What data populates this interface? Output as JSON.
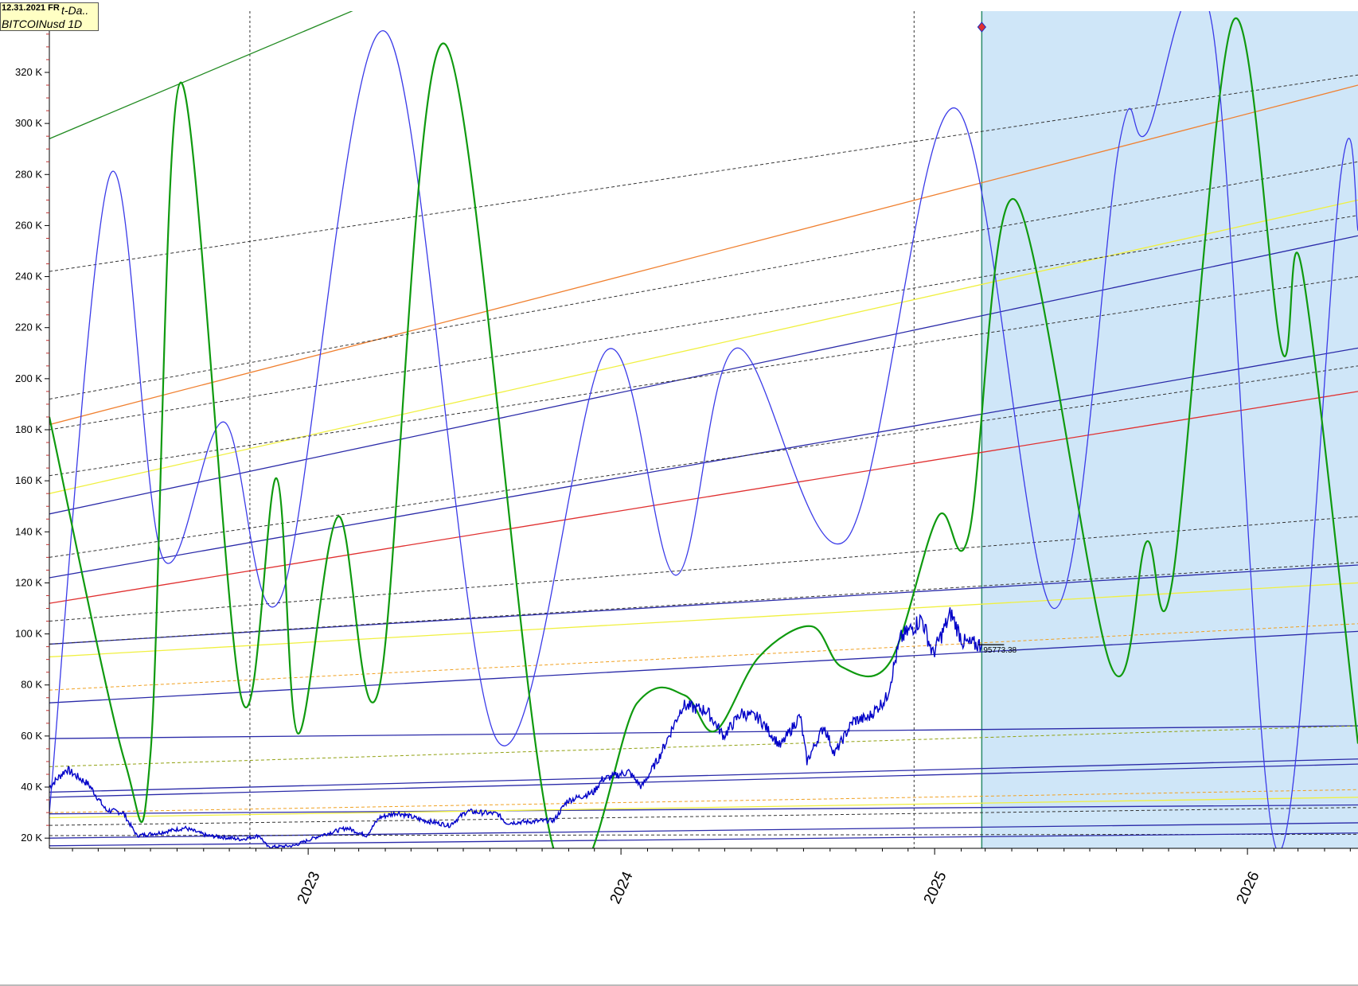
{
  "info_box": {
    "date": "12.31.2021 FR",
    "suffix": "t-Da..",
    "symbol": "BITCOINusd 1D"
  },
  "price_marker": "95773.38",
  "colors": {
    "forecast_zone": "#cfe6f8",
    "price_series": "#0000c8",
    "blue_wave": "#3a3ae8",
    "green_wave": "#0f9a0f"
  },
  "chart_data": {
    "type": "line",
    "title": "",
    "xlabel": "",
    "ylabel": "",
    "x_axis": {
      "type": "date",
      "range": [
        "2022-03-05",
        "2026-05-10"
      ],
      "tick_labels": [
        "2023",
        "2024",
        "2025",
        "2026"
      ],
      "tick_dates": [
        "2023-01-01",
        "2024-01-01",
        "2025-01-01",
        "2026-01-01"
      ]
    },
    "y_axis": {
      "range": [
        16000,
        344000
      ],
      "ticks": [
        20000,
        40000,
        60000,
        80000,
        100000,
        120000,
        140000,
        160000,
        180000,
        200000,
        220000,
        240000,
        260000,
        280000,
        300000,
        320000
      ],
      "tick_labels": [
        "20 K",
        "40 K",
        "60 K",
        "80 K",
        "100 K",
        "120 K",
        "140 K",
        "160 K",
        "180 K",
        "200 K",
        "220 K",
        "240 K",
        "260 K",
        "280 K",
        "300 K",
        "320 K"
      ]
    },
    "grid": false,
    "vertical_markers": [
      "2022-10-25",
      "2024-12-08"
    ],
    "forecast_start": "2025-02-25",
    "last_price": 95773.38,
    "series": [
      {
        "role": "price",
        "points": [
          [
            "2022-03-05",
            40000
          ],
          [
            "2022-03-25",
            47000
          ],
          [
            "2022-04-20",
            41000
          ],
          [
            "2022-05-10",
            31000
          ],
          [
            "2022-05-30",
            30000
          ],
          [
            "2022-06-15",
            21000
          ],
          [
            "2022-07-10",
            22000
          ],
          [
            "2022-08-10",
            24000
          ],
          [
            "2022-09-05",
            21000
          ],
          [
            "2022-10-15",
            19500
          ],
          [
            "2022-11-05",
            21000
          ],
          [
            "2022-11-15",
            16500
          ],
          [
            "2022-12-15",
            17000
          ],
          [
            "2023-01-15",
            21000
          ],
          [
            "2023-02-15",
            24000
          ],
          [
            "2023-03-10",
            21000
          ],
          [
            "2023-03-25",
            28000
          ],
          [
            "2023-04-15",
            30000
          ],
          [
            "2023-05-15",
            27000
          ],
          [
            "2023-06-15",
            25000
          ],
          [
            "2023-07-05",
            30500
          ],
          [
            "2023-08-10",
            29500
          ],
          [
            "2023-08-20",
            26000
          ],
          [
            "2023-09-20",
            26500
          ],
          [
            "2023-10-15",
            27000
          ],
          [
            "2023-10-30",
            34500
          ],
          [
            "2023-11-30",
            38000
          ],
          [
            "2023-12-10",
            43000
          ],
          [
            "2024-01-10",
            46000
          ],
          [
            "2024-01-25",
            40000
          ],
          [
            "2024-02-15",
            52000
          ],
          [
            "2024-03-13",
            72000
          ],
          [
            "2024-04-10",
            70000
          ],
          [
            "2024-04-30",
            60000
          ],
          [
            "2024-05-20",
            69000
          ],
          [
            "2024-06-10",
            67000
          ],
          [
            "2024-07-05",
            56000
          ],
          [
            "2024-07-28",
            68000
          ],
          [
            "2024-08-05",
            50000
          ],
          [
            "2024-08-25",
            64000
          ],
          [
            "2024-09-06",
            53000
          ],
          [
            "2024-09-28",
            66000
          ],
          [
            "2024-10-15",
            67000
          ],
          [
            "2024-11-06",
            75000
          ],
          [
            "2024-11-22",
            98000
          ],
          [
            "2024-12-17",
            106000
          ],
          [
            "2024-12-30",
            92000
          ],
          [
            "2025-01-20",
            108000
          ],
          [
            "2025-02-03",
            97000
          ],
          [
            "2025-02-10",
            96000
          ],
          [
            "2025-02-25",
            95773
          ]
        ]
      },
      {
        "role": "blue-cycle",
        "points": [
          [
            "2022-03-05",
            30000
          ],
          [
            "2022-05-15",
            280000
          ],
          [
            "2022-07-15",
            130000
          ],
          [
            "2022-09-25",
            183000
          ],
          [
            "2022-12-01",
            115000
          ],
          [
            "2023-04-01",
            336000
          ],
          [
            "2023-08-10",
            58000
          ],
          [
            "2023-12-15",
            211000
          ],
          [
            "2024-03-05",
            123000
          ],
          [
            "2024-05-15",
            212000
          ],
          [
            "2024-09-20",
            137000
          ],
          [
            "2025-01-25",
            306000
          ],
          [
            "2025-05-20",
            110000
          ],
          [
            "2025-08-05",
            293000
          ],
          [
            "2025-09-05",
            296000
          ],
          [
            "2025-11-20",
            340000
          ],
          [
            "2026-02-05",
            15000
          ],
          [
            "2026-04-20",
            280000
          ],
          [
            "2026-05-10",
            258000
          ]
        ]
      },
      {
        "role": "green-cycle",
        "points": [
          [
            "2022-03-05",
            185000
          ],
          [
            "2022-06-01",
            50000
          ],
          [
            "2022-07-01",
            53000
          ],
          [
            "2022-08-05",
            316000
          ],
          [
            "2022-10-15",
            75000
          ],
          [
            "2022-11-25",
            161000
          ],
          [
            "2022-12-20",
            61000
          ],
          [
            "2023-02-05",
            146000
          ],
          [
            "2023-03-25",
            79000
          ],
          [
            "2023-06-10",
            331000
          ],
          [
            "2023-10-15",
            15000
          ],
          [
            "2024-01-20",
            73000
          ],
          [
            "2024-03-15",
            76000
          ],
          [
            "2024-04-20",
            62000
          ],
          [
            "2024-06-10",
            91000
          ],
          [
            "2024-08-10",
            103000
          ],
          [
            "2024-09-15",
            87000
          ],
          [
            "2024-11-10",
            89000
          ],
          [
            "2025-01-05",
            146000
          ],
          [
            "2025-02-10",
            139000
          ],
          [
            "2025-04-05",
            270000
          ],
          [
            "2025-07-25",
            88000
          ],
          [
            "2025-09-05",
            136000
          ],
          [
            "2025-10-05",
            120000
          ],
          [
            "2025-12-15",
            340000
          ],
          [
            "2026-02-10",
            211000
          ],
          [
            "2026-03-05",
            244000
          ],
          [
            "2026-05-10",
            57000
          ]
        ]
      },
      {
        "role": "trend-lines",
        "segments": [
          {
            "color": "#228b22",
            "dash": "",
            "from": [
              "2022-03-05",
              294000
            ],
            "to": [
              "2023-02-28",
              345000
            ]
          },
          {
            "color": "#333333",
            "dash": "4,3",
            "from": [
              "2022-03-05",
              242000
            ],
            "to": [
              "2026-05-10",
              319000
            ]
          },
          {
            "color": "#f08030",
            "dash": "",
            "from": [
              "2022-03-05",
              182000
            ],
            "to": [
              "2026-05-10",
              315000
            ]
          },
          {
            "color": "#333333",
            "dash": "4,3",
            "from": [
              "2022-03-05",
              192000
            ],
            "to": [
              "2026-05-10",
              285000
            ]
          },
          {
            "color": "#f0f040",
            "dash": "",
            "from": [
              "2022-03-05",
              155000
            ],
            "to": [
              "2026-05-10",
              270000
            ]
          },
          {
            "color": "#333333",
            "dash": "4,3",
            "from": [
              "2022-03-05",
              180000
            ],
            "to": [
              "2026-05-10",
              264000
            ]
          },
          {
            "color": "#2a2aa8",
            "dash": "",
            "from": [
              "2022-03-05",
              147000
            ],
            "to": [
              "2026-05-10",
              256000
            ]
          },
          {
            "color": "#333333",
            "dash": "4,3",
            "from": [
              "2022-03-05",
              162000
            ],
            "to": [
              "2026-05-10",
              240000
            ]
          },
          {
            "color": "#2a2aa8",
            "dash": "",
            "from": [
              "2022-03-05",
              122000
            ],
            "to": [
              "2026-05-10",
              212000
            ]
          },
          {
            "color": "#333333",
            "dash": "4,3",
            "from": [
              "2022-03-05",
              130000
            ],
            "to": [
              "2026-05-10",
              205000
            ]
          },
          {
            "color": "#e03030",
            "dash": "",
            "from": [
              "2022-03-05",
              112000
            ],
            "to": [
              "2026-05-10",
              195000
            ]
          },
          {
            "color": "#333333",
            "dash": "4,3",
            "from": [
              "2022-03-05",
              105000
            ],
            "to": [
              "2026-05-10",
              146000
            ]
          },
          {
            "color": "#f0f040",
            "dash": "",
            "from": [
              "2022-03-05",
              91000
            ],
            "to": [
              "2026-05-10",
              120000
            ]
          },
          {
            "color": "#2a2aa8",
            "dash": "",
            "from": [
              "2022-03-05",
              96000
            ],
            "to": [
              "2026-05-10",
              127000
            ]
          },
          {
            "color": "#333333",
            "dash": "4,3",
            "from": [
              "2022-03-05",
              96000
            ],
            "to": [
              "2026-05-10",
              128000
            ]
          },
          {
            "color": "#f0a020",
            "dash": "4,3",
            "from": [
              "2022-03-05",
              78000
            ],
            "to": [
              "2026-05-10",
              104000
            ]
          },
          {
            "color": "#2a2aa8",
            "dash": "",
            "from": [
              "2022-03-05",
              73000
            ],
            "to": [
              "2026-05-10",
              101000
            ]
          },
          {
            "color": "#2a2aa8",
            "dash": "",
            "from": [
              "2022-03-05",
              59000
            ],
            "to": [
              "2026-05-10",
              64000
            ]
          },
          {
            "color": "#90a010",
            "dash": "4,3",
            "from": [
              "2022-03-05",
              48000
            ],
            "to": [
              "2026-05-10",
              64000
            ]
          },
          {
            "color": "#2a2aa8",
            "dash": "",
            "from": [
              "2022-03-05",
              38000
            ],
            "to": [
              "2026-05-10",
              51000
            ]
          },
          {
            "color": "#2a2aa8",
            "dash": "",
            "from": [
              "2022-03-05",
              36000
            ],
            "to": [
              "2026-05-10",
              49000
            ]
          },
          {
            "color": "#f0a020",
            "dash": "4,3",
            "from": [
              "2022-03-05",
              30000
            ],
            "to": [
              "2026-05-10",
              39000
            ]
          },
          {
            "color": "#2a2aa8",
            "dash": "",
            "from": [
              "2022-03-05",
              29500
            ],
            "to": [
              "2026-05-10",
              33000
            ]
          },
          {
            "color": "#f0f040",
            "dash": "",
            "from": [
              "2022-03-05",
              28000
            ],
            "to": [
              "2026-05-10",
              36000
            ]
          },
          {
            "color": "#333333",
            "dash": "4,3",
            "from": [
              "2022-03-05",
              25000
            ],
            "to": [
              "2026-05-10",
              32000
            ]
          },
          {
            "color": "#2a2aa8",
            "dash": "",
            "from": [
              "2022-03-05",
              20000
            ],
            "to": [
              "2026-05-10",
              26000
            ]
          },
          {
            "color": "#333333",
            "dash": "4,3",
            "from": [
              "2022-03-05",
              21000
            ],
            "to": [
              "2026-05-10",
              21500
            ]
          },
          {
            "color": "#2a2aa8",
            "dash": "",
            "from": [
              "2022-03-05",
              17000
            ],
            "to": [
              "2026-05-10",
              22000
            ]
          }
        ]
      }
    ]
  }
}
